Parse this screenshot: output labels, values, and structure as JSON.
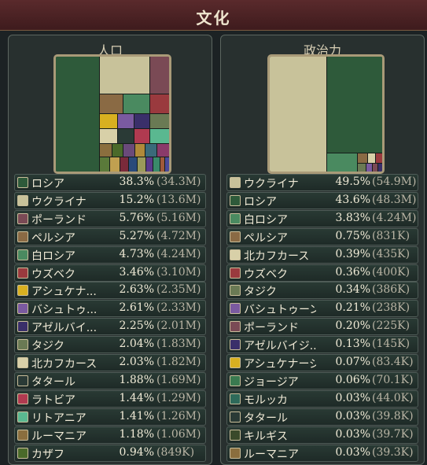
{
  "window": {
    "title": "文化"
  },
  "left": {
    "title": "人口",
    "rows": [
      {
        "name": "ロシア",
        "pct": "38.3%",
        "abs": "(34.3M)",
        "color": "#2e5a3a"
      },
      {
        "name": "ウクライナ",
        "pct": "15.2%",
        "abs": "(13.6M)",
        "color": "#c8c29a"
      },
      {
        "name": "ポーランド",
        "pct": "5.76%",
        "abs": "(5.16M)",
        "color": "#7a4a55"
      },
      {
        "name": "ペルシア",
        "pct": "5.27%",
        "abs": "(4.72M)",
        "color": "#8a6a44"
      },
      {
        "name": "白ロシア",
        "pct": "4.73%",
        "abs": "(4.24M)",
        "color": "#4a8a60"
      },
      {
        "name": "ウズベク",
        "pct": "3.46%",
        "abs": "(3.10M)",
        "color": "#9a3a3e"
      },
      {
        "name": "アシュケナ...",
        "pct": "2.63%",
        "abs": "(2.35M)",
        "color": "#d8b020"
      },
      {
        "name": "バシュトゥ...",
        "pct": "2.61%",
        "abs": "(2.33M)",
        "color": "#7a5aa0"
      },
      {
        "name": "アゼルバイ...",
        "pct": "2.25%",
        "abs": "(2.01M)",
        "color": "#3a2f6a"
      },
      {
        "name": "タジク",
        "pct": "2.04%",
        "abs": "(1.83M)",
        "color": "#6a7a54"
      },
      {
        "name": "北カフカース",
        "pct": "2.03%",
        "abs": "(1.82M)",
        "color": "#d8d0a8"
      },
      {
        "name": "タタール",
        "pct": "1.88%",
        "abs": "(1.69M)",
        "color": "#2a3a36"
      },
      {
        "name": "ラトビア",
        "pct": "1.44%",
        "abs": "(1.29M)",
        "color": "#b03a50"
      },
      {
        "name": "リトアニア",
        "pct": "1.41%",
        "abs": "(1.26M)",
        "color": "#5ab890"
      },
      {
        "name": "ルーマニア",
        "pct": "1.18%",
        "abs": "(1.06M)",
        "color": "#8a6e3e"
      },
      {
        "name": "カザフ",
        "pct": "0.94%",
        "abs": "(849K)",
        "color": "#4a6a2a"
      }
    ]
  },
  "right": {
    "title": "政治力",
    "rows": [
      {
        "name": "ウクライナ",
        "pct": "49.5%",
        "abs": "(54.9M)",
        "color": "#c8c29a"
      },
      {
        "name": "ロシア",
        "pct": "43.6%",
        "abs": "(48.3M)",
        "color": "#2e5a3a"
      },
      {
        "name": "白ロシア",
        "pct": "3.83%",
        "abs": "(4.24M)",
        "color": "#4a8a60"
      },
      {
        "name": "ペルシア",
        "pct": "0.75%",
        "abs": "(831K)",
        "color": "#8a6a44"
      },
      {
        "name": "北カフカース",
        "pct": "0.39%",
        "abs": "(435K)",
        "color": "#d8d0a8"
      },
      {
        "name": "ウズベク",
        "pct": "0.36%",
        "abs": "(400K)",
        "color": "#9a3a3e"
      },
      {
        "name": "タジク",
        "pct": "0.34%",
        "abs": "(386K)",
        "color": "#6a7a54"
      },
      {
        "name": "バシュトゥーン",
        "pct": "0.21%",
        "abs": "(238K)",
        "color": "#7a5aa0"
      },
      {
        "name": "ポーランド",
        "pct": "0.20%",
        "abs": "(225K)",
        "color": "#7a4a55"
      },
      {
        "name": "アゼルバイジ...",
        "pct": "0.13%",
        "abs": "(145K)",
        "color": "#3a2f6a"
      },
      {
        "name": "アシュケナージ",
        "pct": "0.07%",
        "abs": "(83.4K)",
        "color": "#d8b020"
      },
      {
        "name": "ジョージア",
        "pct": "0.06%",
        "abs": "(70.1K)",
        "color": "#3a7a50"
      },
      {
        "name": "モルッカ",
        "pct": "0.03%",
        "abs": "(44.0K)",
        "color": "#2e6a5a"
      },
      {
        "name": "タタール",
        "pct": "0.03%",
        "abs": "(39.8K)",
        "color": "#2a3a36"
      },
      {
        "name": "キルギス",
        "pct": "0.03%",
        "abs": "(39.7K)",
        "color": "#3a4a2a"
      },
      {
        "name": "ルーマニア",
        "pct": "0.03%",
        "abs": "(39.3K)",
        "color": "#8a6e3e"
      }
    ]
  }
}
